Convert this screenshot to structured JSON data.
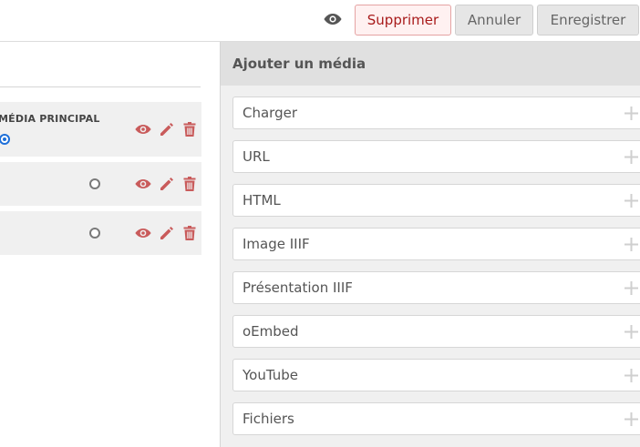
{
  "toolbar": {
    "preview_icon": "eye-icon",
    "delete_label": "Supprimer",
    "cancel_label": "Annuler",
    "save_label": "Enregistrer"
  },
  "media_list": {
    "primary_label": "MÉDIA PRINCIPAL",
    "items": [
      {
        "primary": true,
        "actions": [
          "eye-icon",
          "pencil-icon",
          "trash-icon"
        ]
      },
      {
        "primary": false,
        "actions": [
          "eye-icon",
          "pencil-icon",
          "trash-icon"
        ]
      },
      {
        "primary": false,
        "actions": [
          "eye-icon",
          "pencil-icon",
          "trash-icon"
        ]
      }
    ],
    "action_color": "#c95b5b"
  },
  "add_media": {
    "title": "Ajouter un média",
    "options": [
      {
        "label": "Charger",
        "icon": "plus-icon"
      },
      {
        "label": "URL",
        "icon": "plus-icon"
      },
      {
        "label": "HTML",
        "icon": "plus-icon"
      },
      {
        "label": "Image IIIF",
        "icon": "plus-icon"
      },
      {
        "label": "Présentation IIIF",
        "icon": "plus-icon"
      },
      {
        "label": "oEmbed",
        "icon": "plus-icon"
      },
      {
        "label": "YouTube",
        "icon": "plus-icon"
      },
      {
        "label": "Fichiers",
        "icon": "plus-icon"
      }
    ]
  }
}
